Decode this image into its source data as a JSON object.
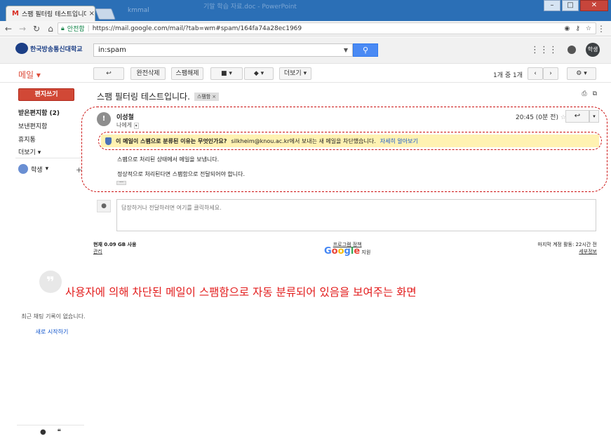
{
  "browser": {
    "tab_title": "스팸 필터링 테스트입니다",
    "tab_close": "×",
    "secure_label": "안전함",
    "url": "https://mail.google.com/mail/?tab=wm#spam/164fa74a28ec1969",
    "win_title_faded": "kmmal",
    "win_title_faded2": "기말 학습 자료.doc - PowerPoint"
  },
  "gmail": {
    "logo_text": "한국방송통신대학교",
    "search_value": "in:spam",
    "avatar_label": "학생",
    "mail_label": "메일",
    "toolbar": {
      "back_label": "↩",
      "delete_forever": "완전삭제",
      "not_spam": "스팸해제",
      "more": "더보기"
    },
    "pager": "1개 중 1개",
    "sidebar": {
      "compose": "편지쓰기",
      "items": [
        "받은편지함 (2)",
        "보낸편지함",
        "휴지통",
        "더보기"
      ],
      "user": "학생",
      "chat_empty": "최근 채팅 기록이 없습니다.",
      "chat_start": "새로 시작하기"
    },
    "thread": {
      "subject": "스팸 필터링 테스트입니다.",
      "label": "스팸함",
      "sender": "이성철",
      "to_me": "나에게",
      "time": "20:45 (0분 전)",
      "spam_question": "이 메일이 스팸으로 분류된 이유는 무엇인가요?",
      "spam_text": "silkheim@knou.ac.kr에서 보내는 새 메일을 차단했습니다.",
      "spam_link": "자세히 알아보기",
      "body_line1": "스팸으로 처리된 상태에서 메일을 보냅니다.",
      "body_line2": "정상적으로 처리된다면 스팸함으로 전달되어야 합니다.",
      "reply_placeholder": "답장하거나 전달하려면 여기를 클릭하세요."
    },
    "footer": {
      "usage": "현재 0.09 GB 사용",
      "manage": "관리",
      "policy": "프로그램 정책",
      "google": "Google",
      "support": "지원",
      "last_activity": "마지막 계정 활동: 22시간 전",
      "details": "세부정보"
    }
  },
  "caption": "사용자에 의해 차단된 메일이 스팸함으로 자동 분류되어 있음을 보여주는 화면",
  "colors": {
    "accent_red": "#dd4b39",
    "annotation_red": "#e21a1a",
    "link": "#1155cc",
    "notice_bg": "#fff2b2"
  }
}
